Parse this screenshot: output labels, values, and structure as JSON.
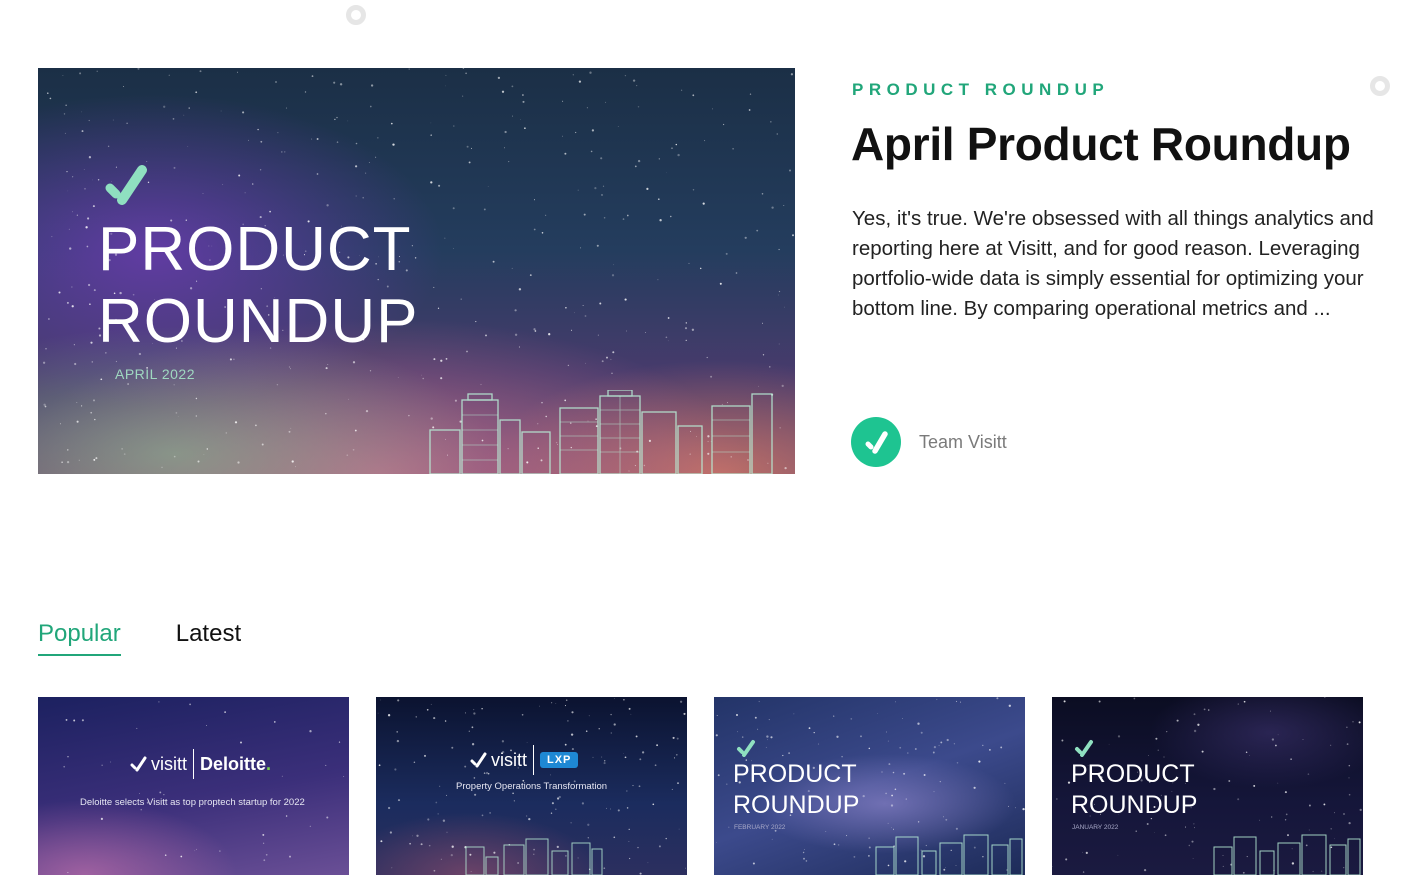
{
  "hero": {
    "image": {
      "title_line1": "PRODUCT",
      "title_line2": "ROUNDUP",
      "subtitle": "APRIL 2022"
    },
    "eyebrow": "PRODUCT ROUNDUP",
    "headline": "April Product Roundup",
    "excerpt": "Yes, it's true. We're obsessed with all things analytics and reporting here at Visitt, and for good reason. Leveraging portfolio-wide data is simply essential for optimizing your bottom line. By comparing operational metrics and ...",
    "author": "Team Visitt",
    "avatar_icon": "visitt-check-logo"
  },
  "tabs": [
    {
      "label": "Popular",
      "active": true
    },
    {
      "label": "Latest",
      "active": false
    }
  ],
  "cards": [
    {
      "brand": "visitt",
      "partner": "Deloitte",
      "partner_dot": ".",
      "caption": "Deloitte selects Visitt as top proptech startup for 2022"
    },
    {
      "brand": "visitt",
      "partner": "LXP",
      "caption": "Property Operations Transformation"
    },
    {
      "title_line1": "PRODUCT",
      "title_line2": "ROUNDUP",
      "date": "FEBRUARY 2022"
    },
    {
      "title_line1": "PRODUCT",
      "title_line2": "ROUNDUP",
      "date": "JANUARY 2022"
    }
  ],
  "colors": {
    "accent": "#21a67a",
    "avatar": "#1ec491",
    "check_mint": "#8fe0c0"
  }
}
